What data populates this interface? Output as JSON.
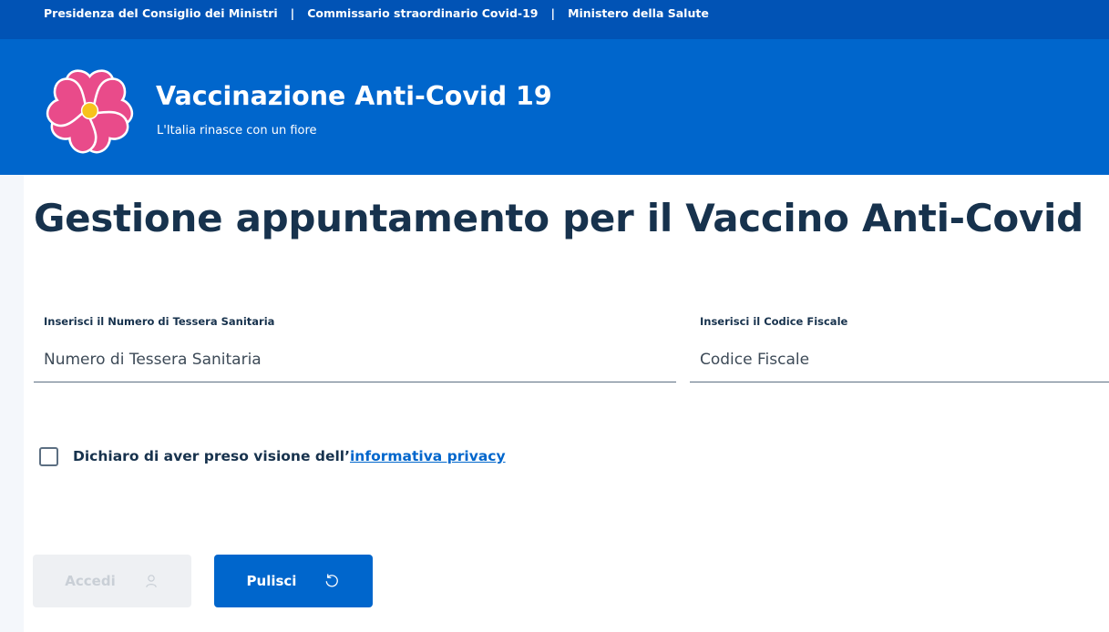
{
  "top_bar": {
    "links": [
      "Presidenza del Consiglio dei Ministri",
      "Commissario straordinario Covid-19",
      "Ministero della Salute"
    ],
    "separator": "|"
  },
  "header": {
    "title": "Vaccinazione Anti-Covid 19",
    "subtitle": "L'Italia rinasce con un fiore",
    "logo_icon": "primrose-flower-icon"
  },
  "main": {
    "title": "Gestione appuntamento per il Vaccino Anti-Covid",
    "fields": [
      {
        "label": "Inserisci il Numero di Tessera Sanitaria",
        "placeholder": "Numero di Tessera Sanitaria",
        "value": ""
      },
      {
        "label": "Inserisci il Codice Fiscale",
        "placeholder": "Codice Fiscale",
        "value": ""
      }
    ],
    "privacy": {
      "text": "Dichiaro di aver preso visione dell’",
      "link": "informativa privacy",
      "checked": false
    },
    "buttons": {
      "accedi": {
        "label": "Accedi",
        "icon": "user-icon",
        "disabled": true
      },
      "pulisci": {
        "label": "Pulisci",
        "icon": "refresh-icon",
        "disabled": false
      }
    }
  },
  "colors": {
    "top_bar": "#0153b5",
    "header": "#0066cc",
    "heading_text": "#17324d",
    "link": "#0066cc",
    "flower_petal": "#e94b8a",
    "flower_center": "#f7c21c",
    "disabled_button": "#eef0f3"
  }
}
